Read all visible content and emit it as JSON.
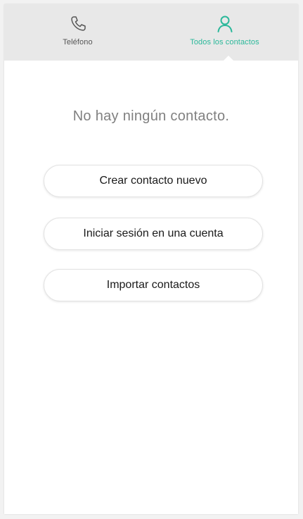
{
  "tabs": {
    "phone": {
      "label": "Teléfono",
      "icon": "phone-icon"
    },
    "contacts": {
      "label": "Todos los contactos",
      "icon": "person-icon",
      "active": true
    }
  },
  "colors": {
    "accent": "#2bb89a",
    "tabbar_bg": "#e8e8e8",
    "page_bg": "#ffffff"
  },
  "main": {
    "empty_message": "No hay ningún contacto.",
    "buttons": [
      {
        "label": "Crear contacto nuevo"
      },
      {
        "label": "Iniciar sesión en una cuenta"
      },
      {
        "label": "Importar contactos"
      }
    ]
  }
}
